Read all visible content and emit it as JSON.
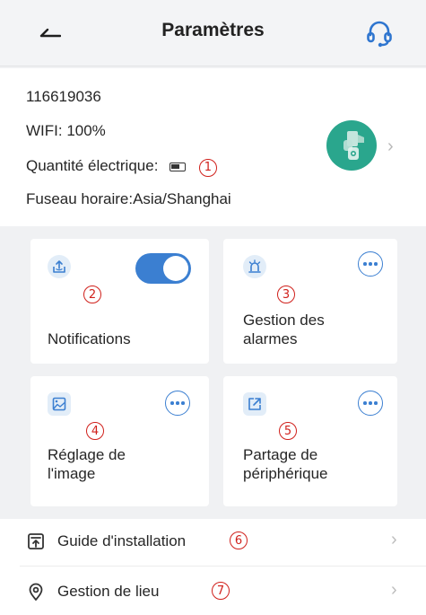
{
  "header": {
    "title": "Paramètres",
    "back_icon": "arrow-left-icon",
    "support_icon": "headset-icon"
  },
  "device": {
    "id": "116619036",
    "wifi": "WIFI: 100%",
    "battery_label": "Quantité électrique:",
    "timezone": "Fuseau horaire:Asia/Shanghai",
    "thumb_color": "#2aa68d",
    "chevron": "›"
  },
  "markers": {
    "m1": "1",
    "m2": "2",
    "m3": "3",
    "m4": "4",
    "m5": "5",
    "m6": "6",
    "m7": "7"
  },
  "cards": {
    "notifications": {
      "label": "Notifications",
      "toggle_on": true
    },
    "alarms": {
      "label_line1": "Gestion des",
      "label_line2": "alarmes"
    },
    "image": {
      "label_line1": "Réglage de",
      "label_line2": "l'image"
    },
    "sharing": {
      "label_line1": "Partage de",
      "label_line2": "périphérique"
    }
  },
  "list": {
    "guide": {
      "label": "Guide d'installation",
      "chevron": "›"
    },
    "location": {
      "label": "Gestion de lieu",
      "chevron": "›"
    }
  },
  "colors": {
    "accent": "#3b7fd1",
    "marker": "#d0201b",
    "background": "#f0f1f3"
  }
}
